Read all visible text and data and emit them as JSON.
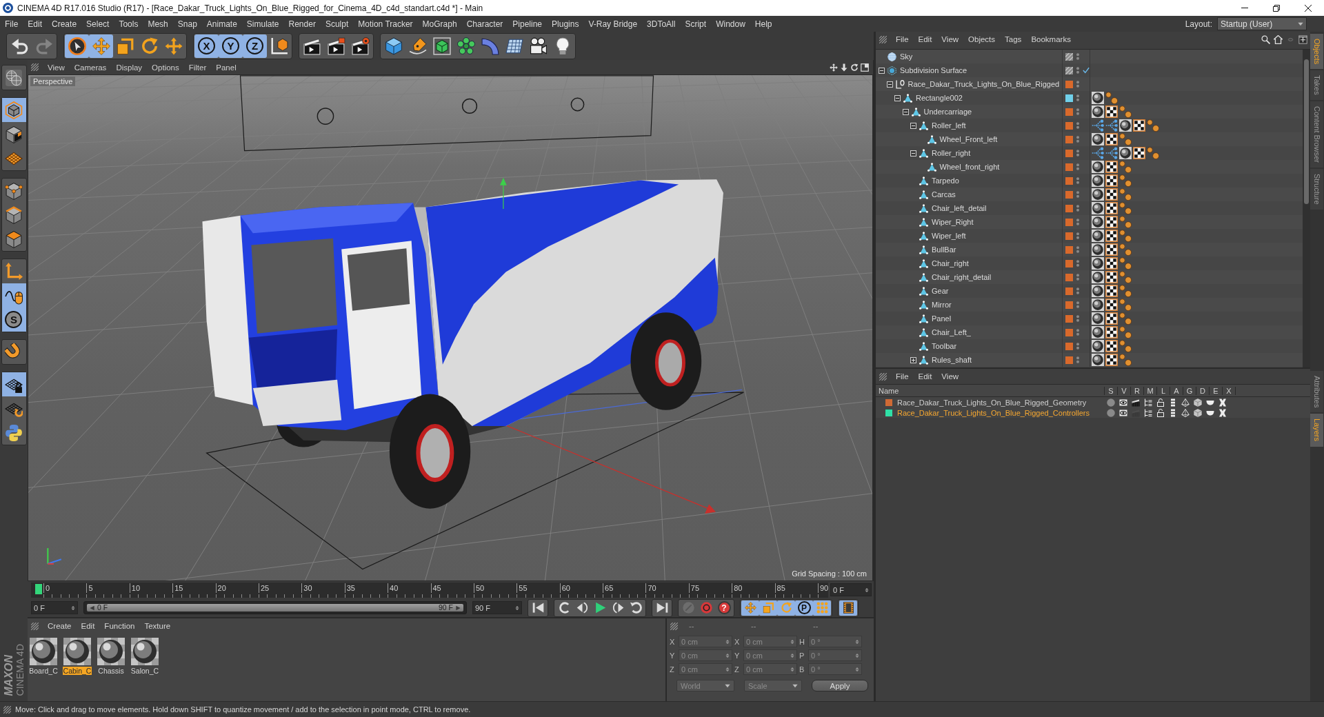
{
  "window": {
    "title": "CINEMA 4D R17.016 Studio (R17) - [Race_Dakar_Truck_Lights_On_Blue_Rigged_for_Cinema_4D_c4d_standart.c4d *] - Main"
  },
  "menu_bar": {
    "items": [
      "File",
      "Edit",
      "Create",
      "Select",
      "Tools",
      "Mesh",
      "Snap",
      "Animate",
      "Simulate",
      "Render",
      "Sculpt",
      "Motion Tracker",
      "MoGraph",
      "Character",
      "Pipeline",
      "Plugins",
      "V-Ray Bridge",
      "3DToAll",
      "Script",
      "Window",
      "Help"
    ],
    "layout_label": "Layout:",
    "layout_value": "Startup (User)"
  },
  "toolbar": [
    [
      {
        "kind": "undo",
        "selected": false,
        "disabled": false
      },
      {
        "kind": "redo",
        "selected": false,
        "disabled": true
      }
    ],
    [
      {
        "kind": "select",
        "selected": true,
        "disabled": false
      },
      {
        "kind": "move",
        "selected": true,
        "disabled": false
      },
      {
        "kind": "scale",
        "selected": false,
        "disabled": false
      },
      {
        "kind": "rotate",
        "selected": false,
        "disabled": false
      },
      {
        "kind": "transform",
        "selected": false,
        "disabled": false
      }
    ],
    [
      {
        "kind": "axis",
        "label": "X",
        "selected": true,
        "disabled": false
      },
      {
        "kind": "axis",
        "label": "Y",
        "selected": true,
        "disabled": false
      },
      {
        "kind": "axis",
        "label": "Z",
        "selected": true,
        "disabled": false
      },
      {
        "kind": "coords",
        "selected": false,
        "disabled": false
      }
    ],
    [
      {
        "kind": "render_view",
        "selected": false,
        "disabled": false
      },
      {
        "kind": "render_pv",
        "selected": false,
        "disabled": false
      },
      {
        "kind": "render_settings",
        "selected": false,
        "disabled": false
      }
    ],
    [
      {
        "kind": "cube",
        "selected": false,
        "disabled": false
      },
      {
        "kind": "pen",
        "selected": false,
        "disabled": false
      },
      {
        "kind": "subdivision",
        "selected": false,
        "disabled": false
      },
      {
        "kind": "cloner",
        "selected": false,
        "disabled": false
      },
      {
        "kind": "deformer",
        "selected": false,
        "disabled": false
      },
      {
        "kind": "floor",
        "selected": false,
        "disabled": false
      },
      {
        "kind": "camera",
        "selected": false,
        "disabled": false
      },
      {
        "kind": "light",
        "selected": false,
        "disabled": false
      }
    ]
  ],
  "left_toolbar": [
    [
      {
        "kind": "model_globe",
        "selected": false
      }
    ],
    [
      {
        "kind": "model",
        "selected": true
      },
      {
        "kind": "texture",
        "selected": false
      },
      {
        "kind": "workplane",
        "selected": false
      }
    ],
    [
      {
        "kind": "points",
        "selected": false
      },
      {
        "kind": "edges",
        "selected": false
      },
      {
        "kind": "polygons",
        "selected": false
      }
    ],
    [
      {
        "kind": "axis_mode",
        "selected": false
      },
      {
        "kind": "tweak",
        "selected": true
      },
      {
        "kind": "solo",
        "label": "S",
        "selected": true
      }
    ],
    [
      {
        "kind": "magnet",
        "selected": false
      }
    ],
    [
      {
        "kind": "grid_lock",
        "selected": true
      },
      {
        "kind": "grid_rotate",
        "selected": false
      },
      {
        "kind": "python",
        "selected": false
      }
    ]
  ],
  "viewport": {
    "menu": [
      "View",
      "Cameras",
      "Display",
      "Options",
      "Filter",
      "Panel"
    ],
    "camera": "Perspective",
    "grid_spacing": "Grid Spacing : 100 cm"
  },
  "timeline": {
    "ticks": [
      "0",
      "5",
      "10",
      "15",
      "20",
      "25",
      "30",
      "35",
      "40",
      "45",
      "50",
      "55",
      "60",
      "65",
      "70",
      "75",
      "80",
      "85",
      "90"
    ],
    "level": 0,
    "frame_field": "0 F"
  },
  "transport": {
    "start_field": "0 F",
    "range_start": "0 F",
    "range_end": "90 F",
    "level": 1,
    "end_field": "90 F",
    "groups": [
      [
        {
          "kind": "go_start",
          "selected": false,
          "disabled": false
        }
      ],
      [
        {
          "kind": "prev_frame",
          "selected": false,
          "disabled": false
        },
        {
          "kind": "prev_key",
          "selected": false,
          "disabled": false
        },
        {
          "kind": "play",
          "selected": false,
          "disabled": false
        },
        {
          "kind": "next_key",
          "selected": false,
          "disabled": false
        },
        {
          "kind": "next_frame",
          "selected": false,
          "disabled": false
        }
      ],
      [
        {
          "kind": "go_end",
          "selected": false,
          "disabled": false
        }
      ],
      [
        {
          "kind": "record_all",
          "selected": false,
          "disabled": true
        },
        {
          "kind": "autokey",
          "selected": false,
          "disabled": false
        },
        {
          "kind": "keyframe_help",
          "label": "?",
          "selected": false,
          "disabled": false
        }
      ],
      [
        {
          "kind": "key_move",
          "selected": true,
          "disabled": false
        },
        {
          "kind": "key_scale",
          "selected": true,
          "disabled": false
        },
        {
          "kind": "key_rotate",
          "selected": true,
          "disabled": false
        },
        {
          "kind": "key_param",
          "label": "P",
          "selected": true,
          "disabled": false
        },
        {
          "kind": "key_points",
          "selected": true,
          "disabled": false
        }
      ],
      [
        {
          "kind": "timeline_window",
          "selected": true,
          "disabled": false
        }
      ]
    ]
  },
  "materials": {
    "menu": [
      "Create",
      "Edit",
      "Function",
      "Texture"
    ],
    "items": [
      {
        "name": "Board_C",
        "selected": false
      },
      {
        "name": "Cabin_C",
        "selected": true
      },
      {
        "name": "Chassis",
        "selected": false
      },
      {
        "name": "Salon_C",
        "selected": false
      }
    ]
  },
  "coordinates": {
    "headers": [
      "--",
      "--",
      "--"
    ],
    "rows": [
      {
        "axis": "X",
        "position": "0 cm",
        "size_axis": "X",
        "size": "0 cm",
        "rot_axis": "H",
        "rotation": "0 °"
      },
      {
        "axis": "Y",
        "position": "0 cm",
        "size_axis": "Y",
        "size": "0 cm",
        "rot_axis": "P",
        "rotation": "0 °"
      },
      {
        "axis": "Z",
        "position": "0 cm",
        "size_axis": "Z",
        "size": "0 cm",
        "rot_axis": "B",
        "rotation": "0 °"
      }
    ],
    "mode": "World",
    "size_mode": "Scale",
    "apply": "Apply"
  },
  "logo": {
    "brand": "MAXON",
    "product": "CINEMA 4D"
  },
  "status_bar": {
    "text": "Move: Click and drag to move elements. Hold down SHIFT to quantize movement / add to the selection in point mode, CTRL to remove."
  },
  "object_manager": {
    "menu": [
      "File",
      "Edit",
      "View",
      "Objects",
      "Tags",
      "Bookmarks"
    ],
    "objects": [
      {
        "name": "Sky",
        "kind": "sky"
      },
      {
        "name": "Subdivision Surface",
        "kind": "subdivision",
        "expanded": true,
        "enabled": true,
        "children": [
          {
            "name": "Race_Dakar_Truck_Lights_On_Blue_Rigged",
            "kind": "null",
            "color": "#d9692b",
            "expanded": true,
            "children": [
              {
                "name": "Rectangle002",
                "kind": "polygon",
                "color": "#70d0ea",
                "expanded": true,
                "tags": [
                  {
                    "kind": "material"
                  },
                  {
                    "kind": "points"
                  }
                ],
                "children": [
                  {
                    "name": "Undercarriage",
                    "kind": "polygon",
                    "color": "#d9692b",
                    "expanded": true,
                    "tags": [
                      {
                        "kind": "material"
                      },
                      {
                        "kind": "checker"
                      },
                      {
                        "kind": "points"
                      }
                    ],
                    "children": [
                      {
                        "name": "Roller_left",
                        "kind": "polygon",
                        "color": "#d9692b",
                        "expanded": true,
                        "tags": [
                          {
                            "kind": "constraint"
                          },
                          {
                            "kind": "constraint"
                          },
                          {
                            "kind": "material"
                          },
                          {
                            "kind": "checker"
                          },
                          {
                            "kind": "points"
                          }
                        ],
                        "children": [
                          {
                            "name": "Wheel_Front_left",
                            "kind": "polygon",
                            "color": "#d9692b",
                            "tags": [
                              {
                                "kind": "material"
                              },
                              {
                                "kind": "checker"
                              },
                              {
                                "kind": "points"
                              }
                            ]
                          }
                        ]
                      },
                      {
                        "name": "Roller_right",
                        "kind": "polygon",
                        "color": "#d9692b",
                        "expanded": true,
                        "tags": [
                          {
                            "kind": "constraint"
                          },
                          {
                            "kind": "constraint"
                          },
                          {
                            "kind": "material"
                          },
                          {
                            "kind": "checker"
                          },
                          {
                            "kind": "points"
                          }
                        ],
                        "children": [
                          {
                            "name": "Wheel_front_right",
                            "kind": "polygon",
                            "color": "#d9692b",
                            "tags": [
                              {
                                "kind": "material"
                              },
                              {
                                "kind": "checker"
                              },
                              {
                                "kind": "points"
                              }
                            ]
                          }
                        ]
                      },
                      {
                        "name": "Tarpedo",
                        "kind": "polygon",
                        "color": "#d9692b",
                        "tags": [
                          {
                            "kind": "material"
                          },
                          {
                            "kind": "checker"
                          },
                          {
                            "kind": "points"
                          }
                        ]
                      },
                      {
                        "name": "Carcas",
                        "kind": "polygon",
                        "color": "#d9692b",
                        "tags": [
                          {
                            "kind": "material"
                          },
                          {
                            "kind": "checker"
                          },
                          {
                            "kind": "points"
                          }
                        ]
                      },
                      {
                        "name": "Chair_left_detail",
                        "kind": "polygon",
                        "color": "#d9692b",
                        "tags": [
                          {
                            "kind": "material"
                          },
                          {
                            "kind": "checker"
                          },
                          {
                            "kind": "points"
                          }
                        ]
                      },
                      {
                        "name": "Wiper_Right",
                        "kind": "polygon",
                        "color": "#d9692b",
                        "tags": [
                          {
                            "kind": "material"
                          },
                          {
                            "kind": "checker"
                          },
                          {
                            "kind": "points"
                          }
                        ]
                      },
                      {
                        "name": "Wiper_left",
                        "kind": "polygon",
                        "color": "#d9692b",
                        "tags": [
                          {
                            "kind": "material"
                          },
                          {
                            "kind": "checker"
                          },
                          {
                            "kind": "points"
                          }
                        ]
                      },
                      {
                        "name": "BullBar",
                        "kind": "polygon",
                        "color": "#d9692b",
                        "tags": [
                          {
                            "kind": "material"
                          },
                          {
                            "kind": "checker"
                          },
                          {
                            "kind": "points"
                          }
                        ]
                      },
                      {
                        "name": "Chair_right",
                        "kind": "polygon",
                        "color": "#d9692b",
                        "tags": [
                          {
                            "kind": "material"
                          },
                          {
                            "kind": "checker"
                          },
                          {
                            "kind": "points"
                          }
                        ]
                      },
                      {
                        "name": "Chair_right_detail",
                        "kind": "polygon",
                        "color": "#d9692b",
                        "tags": [
                          {
                            "kind": "material"
                          },
                          {
                            "kind": "checker"
                          },
                          {
                            "kind": "points"
                          }
                        ]
                      },
                      {
                        "name": "Gear",
                        "kind": "polygon",
                        "color": "#d9692b",
                        "tags": [
                          {
                            "kind": "material"
                          },
                          {
                            "kind": "checker"
                          },
                          {
                            "kind": "points"
                          }
                        ]
                      },
                      {
                        "name": "Mirror",
                        "kind": "polygon",
                        "color": "#d9692b",
                        "tags": [
                          {
                            "kind": "material"
                          },
                          {
                            "kind": "checker"
                          },
                          {
                            "kind": "points"
                          }
                        ]
                      },
                      {
                        "name": "Panel",
                        "kind": "polygon",
                        "color": "#d9692b",
                        "tags": [
                          {
                            "kind": "material"
                          },
                          {
                            "kind": "checker"
                          },
                          {
                            "kind": "points"
                          }
                        ]
                      },
                      {
                        "name": "Chair_Left_",
                        "kind": "polygon",
                        "color": "#d9692b",
                        "tags": [
                          {
                            "kind": "material"
                          },
                          {
                            "kind": "checker"
                          },
                          {
                            "kind": "points"
                          }
                        ]
                      },
                      {
                        "name": "Toolbar",
                        "kind": "polygon",
                        "color": "#d9692b",
                        "tags": [
                          {
                            "kind": "material"
                          },
                          {
                            "kind": "checker"
                          },
                          {
                            "kind": "points"
                          }
                        ]
                      },
                      {
                        "name": "Rules_shaft",
                        "kind": "polygon",
                        "color": "#d9692b",
                        "expanded": false,
                        "tags": [
                          {
                            "kind": "material"
                          },
                          {
                            "kind": "checker"
                          },
                          {
                            "kind": "points"
                          }
                        ]
                      }
                    ]
                  }
                ]
              }
            ]
          }
        ]
      }
    ]
  },
  "layer_manager": {
    "menu": [
      "File",
      "Edit",
      "View"
    ],
    "columns": [
      "Name",
      "S",
      "V",
      "R",
      "M",
      "L",
      "A",
      "G",
      "D",
      "E",
      "X"
    ],
    "rows": [
      {
        "name": "Race_Dakar_Truck_Lights_On_Blue_Rigged_Geometry",
        "color": "#cf6a35",
        "selected": false,
        "render": true
      },
      {
        "name": "Race_Dakar_Truck_Lights_On_Blue_Rigged_Controllers",
        "color": "#2fe0a6",
        "selected": true,
        "render": false
      }
    ]
  },
  "side_tabs": {
    "top": [
      {
        "label": "Objects",
        "selected": true
      },
      {
        "label": "Takes",
        "selected": false
      },
      {
        "label": "Content Browser",
        "selected": false
      },
      {
        "label": "Structure",
        "selected": false
      }
    ],
    "bottom": [
      {
        "label": "Attributes",
        "selected": false
      },
      {
        "label": "Layers",
        "selected": true
      }
    ]
  }
}
